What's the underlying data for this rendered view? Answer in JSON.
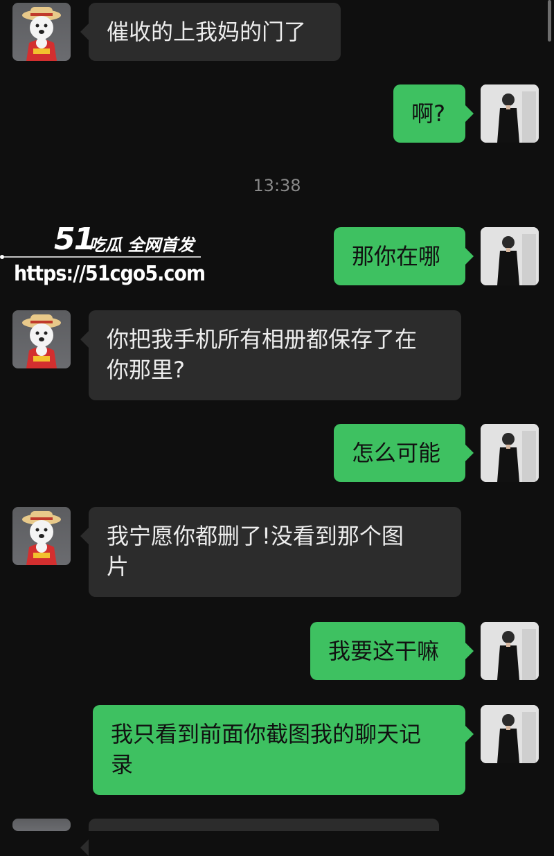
{
  "timestamp": "13:38",
  "watermark": {
    "logo": "51",
    "title": "吃瓜 全网首发",
    "url": "https://51cgo5.com"
  },
  "messages": [
    {
      "side": "in",
      "avatar": "dog-avatar",
      "text": "催收的上我妈的门了"
    },
    {
      "side": "out",
      "avatar": "man-avatar",
      "text": "啊?"
    },
    {
      "side": "out",
      "avatar": "man-avatar",
      "text": "那你在哪"
    },
    {
      "side": "in",
      "avatar": "dog-avatar",
      "lines": [
        "你把我手机所有相册都保存了在",
        "你那里?"
      ]
    },
    {
      "side": "out",
      "avatar": "man-avatar",
      "text": "怎么可能"
    },
    {
      "side": "in",
      "avatar": "dog-avatar",
      "lines": [
        "我宁愿你都删了!没看到那个图",
        "片"
      ]
    },
    {
      "side": "out",
      "avatar": "man-avatar",
      "text": "我要这干嘛"
    },
    {
      "side": "out",
      "avatar": "man-avatar",
      "lines": [
        "我只看到前面你截图我的聊天记",
        "录"
      ]
    }
  ]
}
